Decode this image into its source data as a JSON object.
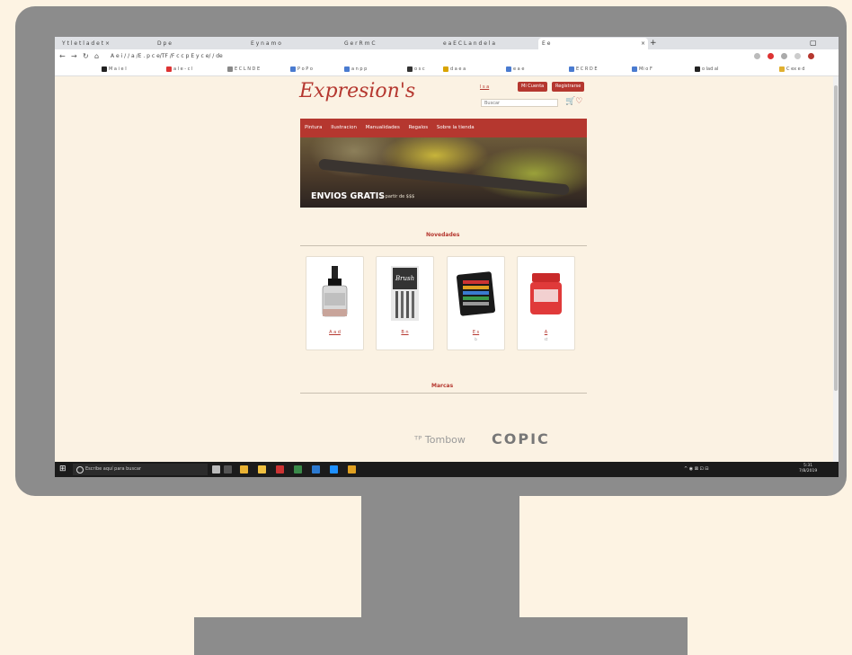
{
  "browser": {
    "tabs": [
      {
        "label": "Y  t  l    e  t l    a d    e   t  ×"
      },
      {
        "label": "D  p         e"
      },
      {
        "label": "E  y  n  a     m  o"
      },
      {
        "label": "G   e       r   R       m C"
      },
      {
        "label": "e  a  E C  L a  n d    e   l  a"
      },
      {
        "label": "E     e"
      }
    ],
    "new_tab": "+",
    "window_controls": "▢",
    "address": "A e   i    /    / a /E . p c e/TF /F c c p E  y    c           e/   /  de",
    "bookmarks": [
      {
        "label": "M a    i    e  I",
        "color": "#222"
      },
      {
        "label": "a  l  e  -  c  l",
        "color": "#d33"
      },
      {
        "label": "E C L  N D E",
        "color": "#888"
      },
      {
        "label": "P o   P o",
        "color": "#4a7bd0"
      },
      {
        "label": "a   n  p p",
        "color": "#4a7bd0"
      },
      {
        "label": "o s   c",
        "color": "#333"
      },
      {
        "label": "d  a   e   a",
        "color": "#d9a400"
      },
      {
        "label": "e   a   e",
        "color": "#4a7bd0"
      },
      {
        "label": "E C  R  D E",
        "color": "#4a7bd0"
      },
      {
        "label": "Mi o  F",
        "color": "#4a7bd0"
      },
      {
        "label": "o  lad   al",
        "color": "#222"
      },
      {
        "label": "C  ex  e  d",
        "color": "#e0b030"
      }
    ]
  },
  "site": {
    "logo": "Expresion's",
    "top_links": "l  s  a",
    "account_button": "Mi Cuenta",
    "register_button": "Registrarse",
    "search_placeholder": "Buscar",
    "cart_icon": "🛒",
    "wishlist_icon": "♡",
    "menu": [
      "Pintura",
      "Ilustracion",
      "Manualidades",
      "Regalos",
      "Sobre la tienda"
    ],
    "banner": {
      "title": "ENVIOS GRATIS",
      "subtitle": "a partir de $$$"
    },
    "novedades_title": "Novedades",
    "products": [
      {
        "label": "A    a d",
        "sub": ""
      },
      {
        "label": "B  n",
        "sub": ""
      },
      {
        "label": "E  s",
        "sub": "b"
      },
      {
        "label": "A",
        "sub": "st"
      }
    ],
    "marcas_title": "Marcas",
    "brands": [
      "ᵀᴾ Tombow",
      "COPIC"
    ]
  },
  "taskbar": {
    "start": "⊞",
    "search_text": "Escribe aquí para buscar",
    "tray_text": "^ ◉ ⊠ ⊡ ⊟",
    "time": "5:31",
    "date": "7/8/2019"
  }
}
